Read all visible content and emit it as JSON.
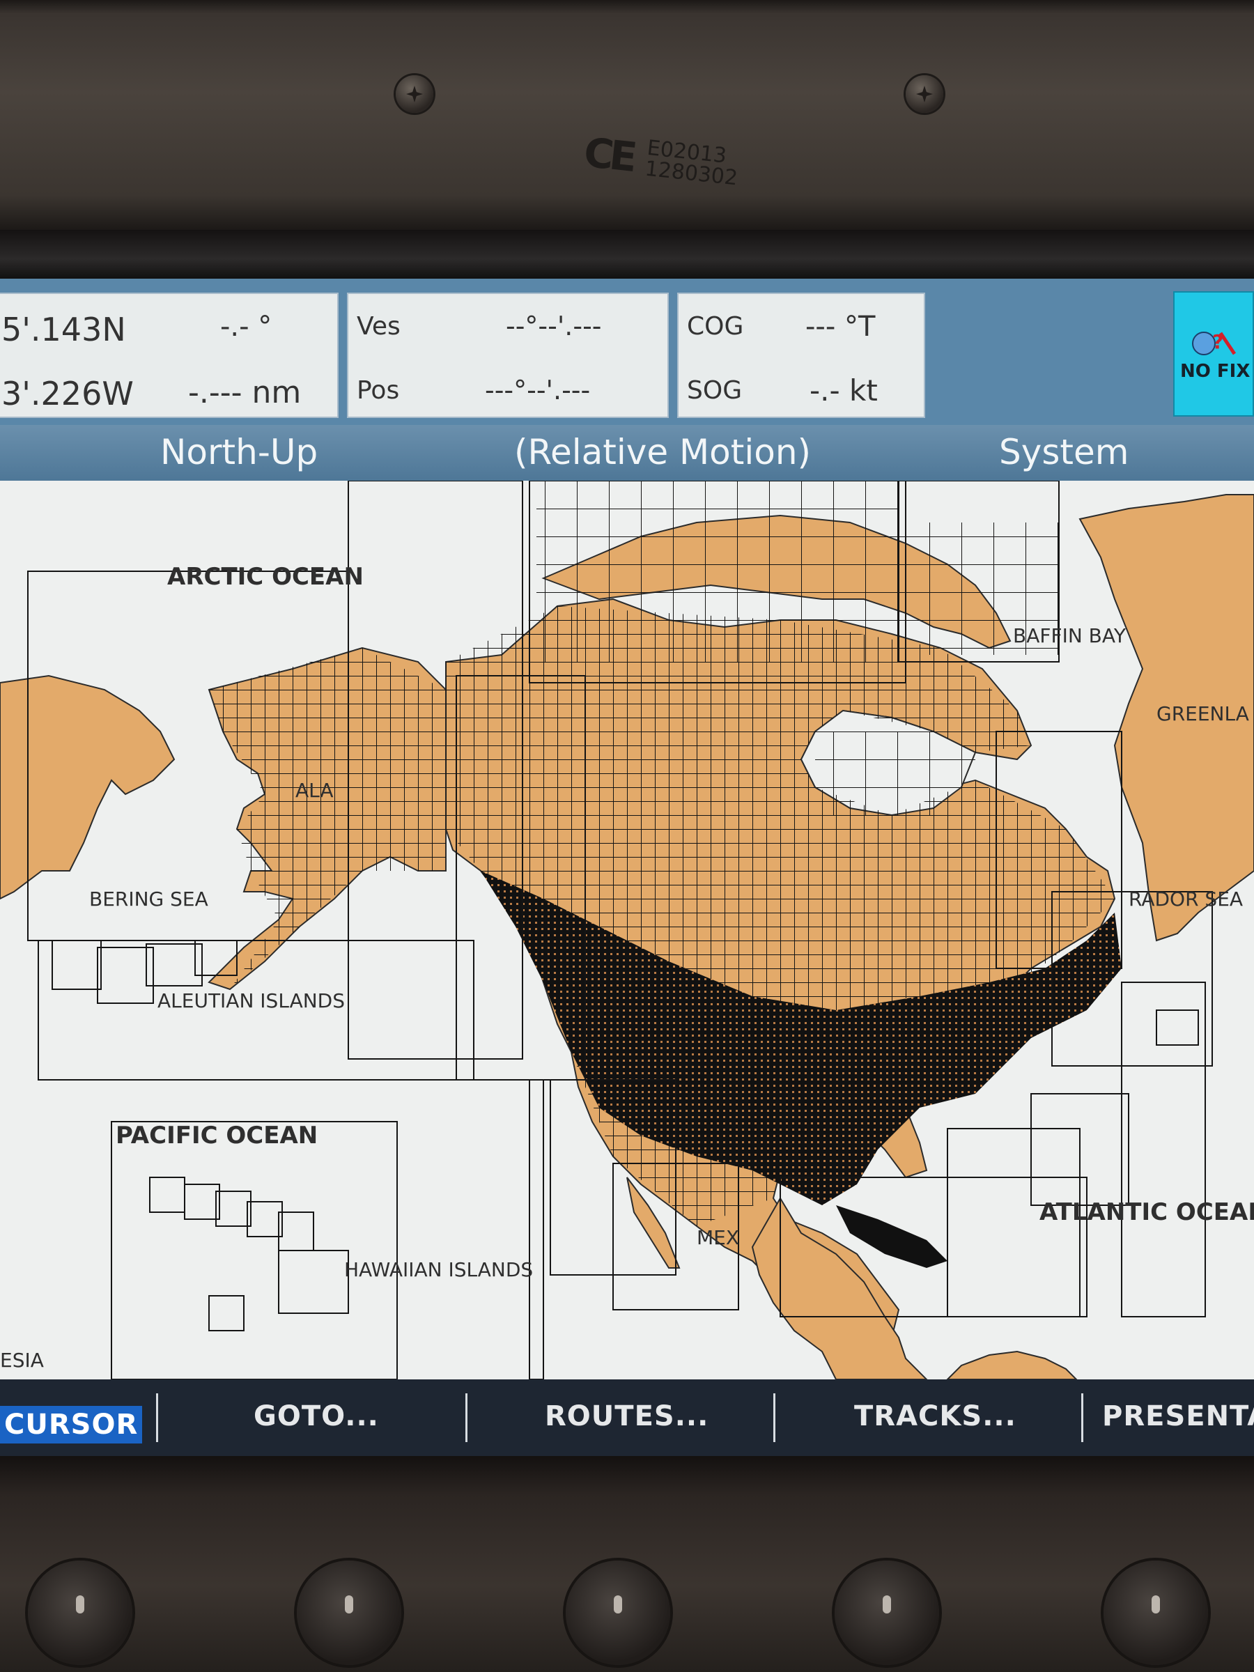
{
  "device": {
    "ce_mark": "CE",
    "codes": [
      "E02013",
      "1280302"
    ]
  },
  "nav_panel": {
    "position": {
      "lat": "5'.143N",
      "lon": "3'.226W",
      "bearing": "-.- °",
      "distance": "-.--- nm"
    },
    "vessel": {
      "ves_label": "Ves",
      "ves_value": "--°--'.---",
      "pos_label": "Pos",
      "pos_value": "---°--'.---"
    },
    "course": {
      "cog_label": "COG",
      "cog_value": "--- °T",
      "sog_label": "SOG",
      "sog_value": "-.- kt"
    },
    "fix_status": "NO FIX"
  },
  "status_bar": {
    "orientation": "North-Up",
    "motion": "(Relative Motion)",
    "mode": "System"
  },
  "map": {
    "labels": {
      "arctic": "ARCTIC OCEAN",
      "baffin": "BAFFIN BAY",
      "greenland": "GREENLA",
      "alaska": "ALA",
      "bering": "BERING SEA",
      "aleutian": "ALEUTIAN ISLANDS",
      "labrador": "RADOR SEA",
      "pacific": "PACIFIC OCEAN",
      "atlantic": "ATLANTIC OCEAN",
      "hawaiian": "HAWAIIAN ISLANDS",
      "asia": "ESIA",
      "mexico": "MEX"
    },
    "colors": {
      "land": "#e3aa6a",
      "sea": "#eef0ef",
      "chart_outline": "#141414"
    }
  },
  "softkeys": {
    "cursor": "CURSOR",
    "goto": "GOTO...",
    "routes": "ROUTES...",
    "tracks": "TRACKS...",
    "presentation": "PRESENTA"
  }
}
